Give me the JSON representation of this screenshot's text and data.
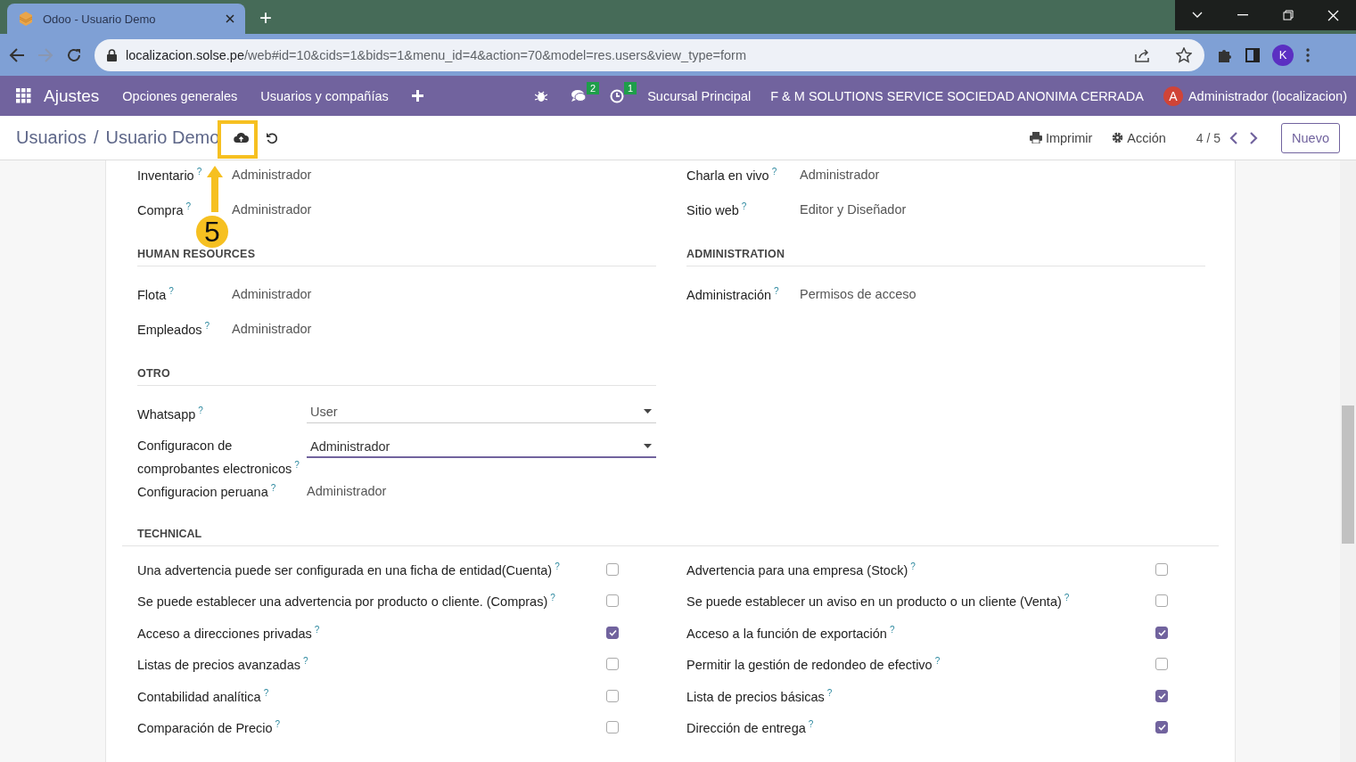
{
  "browser": {
    "tab_title": "Odoo - Usuario Demo",
    "new_tab": "+",
    "url": {
      "host": "localizacion.solse.pe",
      "path": "/web#id=10&cids=1&bids=1&menu_id=4&action=70&model=res.users&view_type=form"
    },
    "profile": "K"
  },
  "navbar": {
    "app": "Ajustes",
    "menus": [
      "Opciones generales",
      "Usuarios y compañías"
    ],
    "chat_count": "2",
    "activity_count": "1",
    "branch": "Sucursal Principal",
    "company": "F & M SOLUTIONS SERVICE SOCIEDAD ANONIMA CERRADA",
    "user_initial": "A",
    "user": "Administrador (localizacion)"
  },
  "control_panel": {
    "breadcrumb_parent": "Usuarios",
    "breadcrumb_separator": "/",
    "breadcrumb_current": "Usuario Demo",
    "print": "Imprimir",
    "action": "Acción",
    "pager": "4 / 5",
    "new": "Nuevo"
  },
  "annotation": {
    "step": "5"
  },
  "top_fields": {
    "left": [
      {
        "label": "Inventario",
        "help": "?",
        "value": "Administrador",
        "kind": "text"
      },
      {
        "label": "Compra",
        "help": "?",
        "value": "Administrador",
        "kind": "text"
      }
    ],
    "right": [
      {
        "label": "Charla en vivo",
        "help": "?",
        "value": "Administrador",
        "kind": "text"
      },
      {
        "label": "Sitio web",
        "help": "?",
        "value": "Editor y Diseñador",
        "kind": "text"
      }
    ]
  },
  "groups": [
    {
      "left": {
        "title": "HUMAN RESOURCES",
        "fields": [
          {
            "label": "Flota",
            "help": "?",
            "value": "Administrador",
            "kind": "text"
          },
          {
            "label": "Empleados",
            "help": "?",
            "value": "Administrador",
            "kind": "text"
          }
        ]
      },
      "right": {
        "title": "ADMINISTRATION",
        "fields": [
          {
            "label": "Administración",
            "help": "?",
            "value": "Permisos de acceso",
            "kind": "text"
          }
        ]
      }
    },
    {
      "left": {
        "title": "OTRO",
        "fields": [
          {
            "label": "Whatsapp",
            "help": "?",
            "value": "User",
            "kind": "select",
            "focused": false
          },
          {
            "label": "Configuracon de comprobantes electronicos",
            "help": "?",
            "value": "Administrador",
            "kind": "select",
            "focused": true
          },
          {
            "label": "Configuracion peruana",
            "help": "?",
            "value": "Administrador",
            "kind": "text"
          }
        ]
      }
    }
  ],
  "technical": {
    "title": "TECHNICAL",
    "left": [
      {
        "label": "Una advertencia puede ser configurada en una ficha de entidad(Cuenta)",
        "help": "?",
        "checked": false
      },
      {
        "label": "Se puede establecer una advertencia por producto o cliente. (Compras)",
        "help": "?",
        "checked": false
      },
      {
        "label": "Acceso a direcciones privadas",
        "help": "?",
        "checked": true
      },
      {
        "label": "Listas de precios avanzadas",
        "help": "?",
        "checked": false
      },
      {
        "label": "Contabilidad analítica",
        "help": "?",
        "checked": false
      },
      {
        "label": "Comparación de Precio",
        "help": "?",
        "checked": false
      }
    ],
    "right": [
      {
        "label": "Advertencia para una empresa (Stock)",
        "help": "?",
        "checked": false
      },
      {
        "label": "Se puede establecer un aviso en un producto o un cliente (Venta)",
        "help": "?",
        "checked": false
      },
      {
        "label": "Acceso a la función de exportación",
        "help": "?",
        "checked": true
      },
      {
        "label": "Permitir la gestión de redondeo de efectivo",
        "help": "?",
        "checked": false
      },
      {
        "label": "Lista de precios básicas",
        "help": "?",
        "checked": true
      },
      {
        "label": "Dirección de entrega",
        "help": "?",
        "checked": true
      }
    ]
  }
}
